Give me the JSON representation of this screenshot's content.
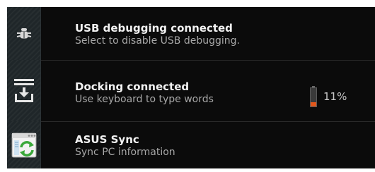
{
  "notifications": [
    {
      "title": "USB debugging connected",
      "subtitle": "Select to disable USB debugging.",
      "icon": "bug-icon"
    },
    {
      "title": "Docking connected",
      "subtitle": "Use keyboard to type words",
      "icon": "dock-download-icon",
      "battery": {
        "label": "11%",
        "level": 0.11,
        "fill_color": "#e2571b"
      }
    },
    {
      "title": "ASUS Sync",
      "subtitle": "Sync PC information",
      "icon": "asus-sync-icon"
    }
  ]
}
